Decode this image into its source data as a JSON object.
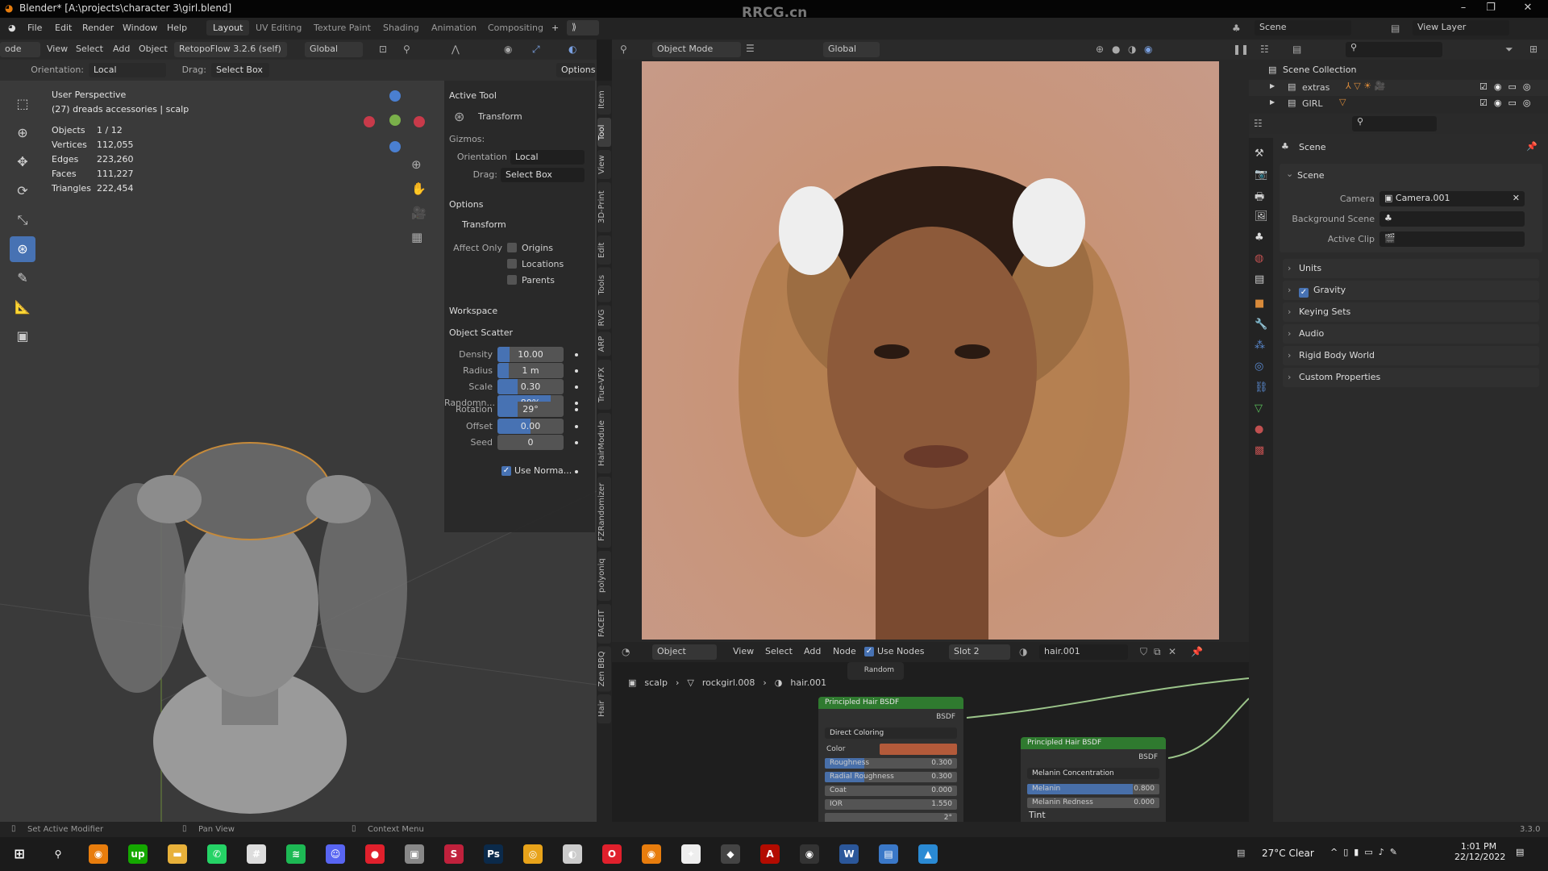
{
  "window": {
    "title": "Blender* [A:\\projects\\character 3\\girl.blend]",
    "watermark": "RRCG.cn",
    "minimize": "–",
    "maximize": "❐",
    "close": "✕"
  },
  "menu": [
    "File",
    "Edit",
    "Render",
    "Window",
    "Help"
  ],
  "workspaces": [
    {
      "label": "Layout",
      "active": true
    },
    {
      "label": "UV Editing"
    },
    {
      "label": "Texture Paint"
    },
    {
      "label": "Shading"
    },
    {
      "label": "Animation"
    },
    {
      "label": "Compositing"
    }
  ],
  "add_ws": "+",
  "scene_selector": {
    "value": "Scene"
  },
  "view_layer": {
    "value": "View Layer"
  },
  "viewport": {
    "mode": "ode",
    "menu": [
      "View",
      "Select",
      "Add",
      "Object"
    ],
    "retopo": "RetopoFlow 3.2.6 (self)",
    "orientation": "Global",
    "tool_settings": {
      "orientation_label": "Orientation:",
      "orientation": "Local",
      "drag_label": "Drag:",
      "drag": "Select Box",
      "options": "Options"
    },
    "overlay_title": "User Perspective",
    "overlay_sub": "(27) dreads accessories | scalp",
    "stats": [
      {
        "k": "Objects",
        "v": "1 / 12"
      },
      {
        "k": "Vertices",
        "v": "112,055"
      },
      {
        "k": "Edges",
        "v": "223,260"
      },
      {
        "k": "Faces",
        "v": "111,227"
      },
      {
        "k": "Triangles",
        "v": "222,454"
      }
    ]
  },
  "npanel": {
    "active_tool": "Active Tool",
    "tool_name": "Transform",
    "gizmos": "Gizmos:",
    "orientation_label": "Orientation",
    "orientation": "Local",
    "drag_label": "Drag:",
    "drag": "Select Box",
    "options": "Options",
    "transform": "Transform",
    "affect_only": "Affect Only",
    "affect": [
      {
        "label": "Origins",
        "checked": false
      },
      {
        "label": "Locations",
        "checked": false
      },
      {
        "label": "Parents",
        "checked": false
      }
    ],
    "workspace": "Workspace",
    "object_scatter": "Object Scatter",
    "scatter": [
      {
        "label": "Density",
        "value": "10.00",
        "fill": 0.18
      },
      {
        "label": "Radius",
        "value": "1 m",
        "fill": 0.17
      },
      {
        "label": "Scale",
        "value": "0.30",
        "fill": 0.3
      },
      {
        "label": "Randomn...",
        "value": "80%",
        "fill": 0.8
      }
    ],
    "use_normal": {
      "label": "Use Norma...",
      "checked": true
    },
    "scatter2": [
      {
        "label": "Rotation",
        "value": "29°",
        "fill": 0.3
      },
      {
        "label": "Offset",
        "value": "0.00",
        "fill": 0.5
      },
      {
        "label": "Seed",
        "value": "0",
        "fill": 0
      }
    ],
    "tabs": [
      "Item",
      "Tool",
      "View",
      "3D-Print",
      "Edit",
      "Tools",
      "RVG",
      "ARP",
      "True-VFX",
      "HairModule",
      "FZRandomizer",
      "polyoniq",
      "FACEIT",
      "Zen BBQ",
      "Hair"
    ]
  },
  "image_view": {
    "mode": "Object Mode",
    "orientation": "Global"
  },
  "node_editor": {
    "type": "Object",
    "menu": [
      "View",
      "Select",
      "Add",
      "Node"
    ],
    "use_nodes": "Use Nodes",
    "slot": "Slot 2",
    "material": "hair.001",
    "breadcrumb": [
      "scalp",
      "rockgirl.008",
      "hair.001"
    ],
    "random_socket": "Random",
    "node1": {
      "title": "Principled Hair BSDF",
      "output": "BSDF",
      "mode": "Direct Coloring",
      "color_label": "Color",
      "color": "#b35a3a",
      "inputs": [
        {
          "label": "Roughness",
          "value": "0.300",
          "fill": 0.3
        },
        {
          "label": "Radial Roughness",
          "value": "0.300",
          "fill": 0.3
        },
        {
          "label": "Coat",
          "value": "0.000",
          "fill": 0
        },
        {
          "label": "IOR",
          "value": "1.550",
          "fill": 0
        },
        {
          "label": "",
          "value": "2°",
          "fill": 0
        }
      ]
    },
    "node2": {
      "title": "Principled Hair BSDF",
      "output": "BSDF",
      "mode": "Melanin Concentration",
      "inputs": [
        {
          "label": "Melanin",
          "value": "0.800",
          "fill": 0.8
        },
        {
          "label": "Melanin Redness",
          "value": "0.000",
          "fill": 0
        }
      ],
      "tint": "Tint"
    }
  },
  "outliner": {
    "root": "Scene Collection",
    "items": [
      {
        "name": "extras",
        "badges": [
          "2",
          "3",
          "5"
        ]
      },
      {
        "name": "GIRL",
        "badges": [
          "7"
        ]
      }
    ]
  },
  "properties": {
    "header": "Scene",
    "panel": "Scene",
    "camera_label": "Camera",
    "camera": "Camera.001",
    "bg_label": "Background Scene",
    "clip_label": "Active Clip",
    "sections": [
      {
        "label": "Units"
      },
      {
        "label": "Gravity",
        "checked": true
      },
      {
        "label": "Keying Sets"
      },
      {
        "label": "Audio"
      },
      {
        "label": "Rigid Body World"
      },
      {
        "label": "Custom Properties"
      }
    ]
  },
  "status": {
    "left": "Set Active Modifier",
    "mid": "Pan View",
    "right": "Context Menu",
    "version": "3.3.0"
  },
  "taskbar": {
    "weather": "27°C  Clear",
    "time": "1:01 PM",
    "date": "22/12/2022",
    "apps": [
      {
        "n": "blender",
        "c": "#e87d0d",
        "g": "◉"
      },
      {
        "n": "upwork",
        "c": "#14a800",
        "g": "up"
      },
      {
        "n": "file-explorer",
        "c": "#e8b13a",
        "g": "▬"
      },
      {
        "n": "whatsapp",
        "c": "#25d366",
        "g": "✆"
      },
      {
        "n": "slack",
        "c": "#ddd",
        "g": "#"
      },
      {
        "n": "spotify",
        "c": "#1db954",
        "g": "≋"
      },
      {
        "n": "discord",
        "c": "#5865f2",
        "g": "☺"
      },
      {
        "n": "app-red",
        "c": "#e0202c",
        "g": "●"
      },
      {
        "n": "app-gray",
        "c": "#888",
        "g": "▣"
      },
      {
        "n": "app-s",
        "c": "#c0213c",
        "g": "S"
      },
      {
        "n": "photoshop",
        "c": "#0b2a4a",
        "g": "Ps"
      },
      {
        "n": "chrome",
        "c": "#e8a31a",
        "g": "◎"
      },
      {
        "n": "app-pink",
        "c": "#ccc",
        "g": "◐"
      },
      {
        "n": "opera",
        "c": "#e0202c",
        "g": "O"
      },
      {
        "n": "blender-2",
        "c": "#e87d0d",
        "g": "◉"
      },
      {
        "n": "app-figure",
        "c": "#eee",
        "g": "✦"
      },
      {
        "n": "app-dark",
        "c": "#444",
        "g": "◆"
      },
      {
        "n": "acrobat",
        "c": "#b30b00",
        "g": "A"
      },
      {
        "n": "obs",
        "c": "#333",
        "g": "◉"
      },
      {
        "n": "word",
        "c": "#2b579a",
        "g": "W"
      },
      {
        "n": "app-blue",
        "c": "#3a78c8",
        "g": "▤"
      },
      {
        "n": "photos",
        "c": "#2a8ad4",
        "g": "▲"
      }
    ]
  },
  "colors": {
    "accent": "#4772b3",
    "node_header": "#2f7a2f",
    "blender_orange": "#e87d0d"
  }
}
